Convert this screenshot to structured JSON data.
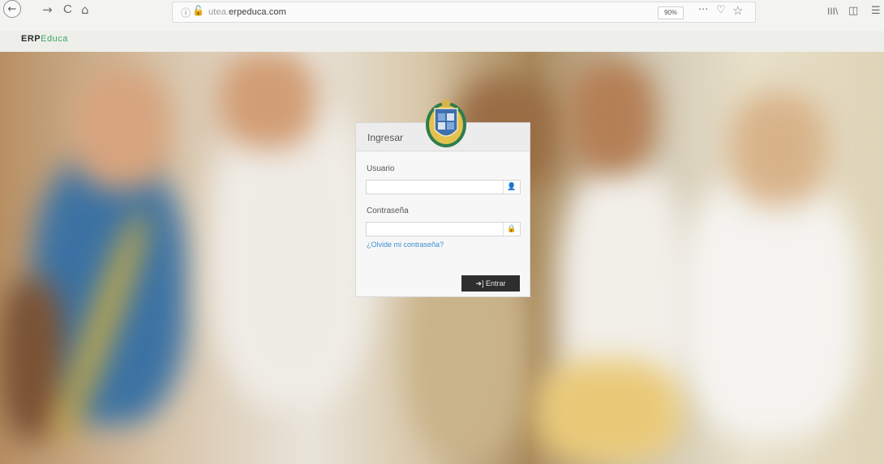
{
  "browser": {
    "url_prefix": "utea.",
    "url_domain": "erpeduca.com",
    "zoom": "90%",
    "nav_back": "←",
    "nav_forward": "→",
    "nav_reload": "C",
    "nav_home": "⌂",
    "page_actions": "···",
    "pocket": "♡",
    "bookmark": "☆",
    "library": "III\\",
    "sidebar": "◫",
    "menu": "☰"
  },
  "site": {
    "logo_erp": "ERP",
    "logo_educa": "Educa"
  },
  "login": {
    "title": "Ingresar",
    "username_label": "Usuario",
    "username_value": "",
    "password_label": "Contraseña",
    "password_value": "",
    "forgot_link": "¿Olvide mi contraseña?",
    "submit_label": "Entrar",
    "user_icon": "user-icon",
    "lock_icon": "lock-icon"
  }
}
